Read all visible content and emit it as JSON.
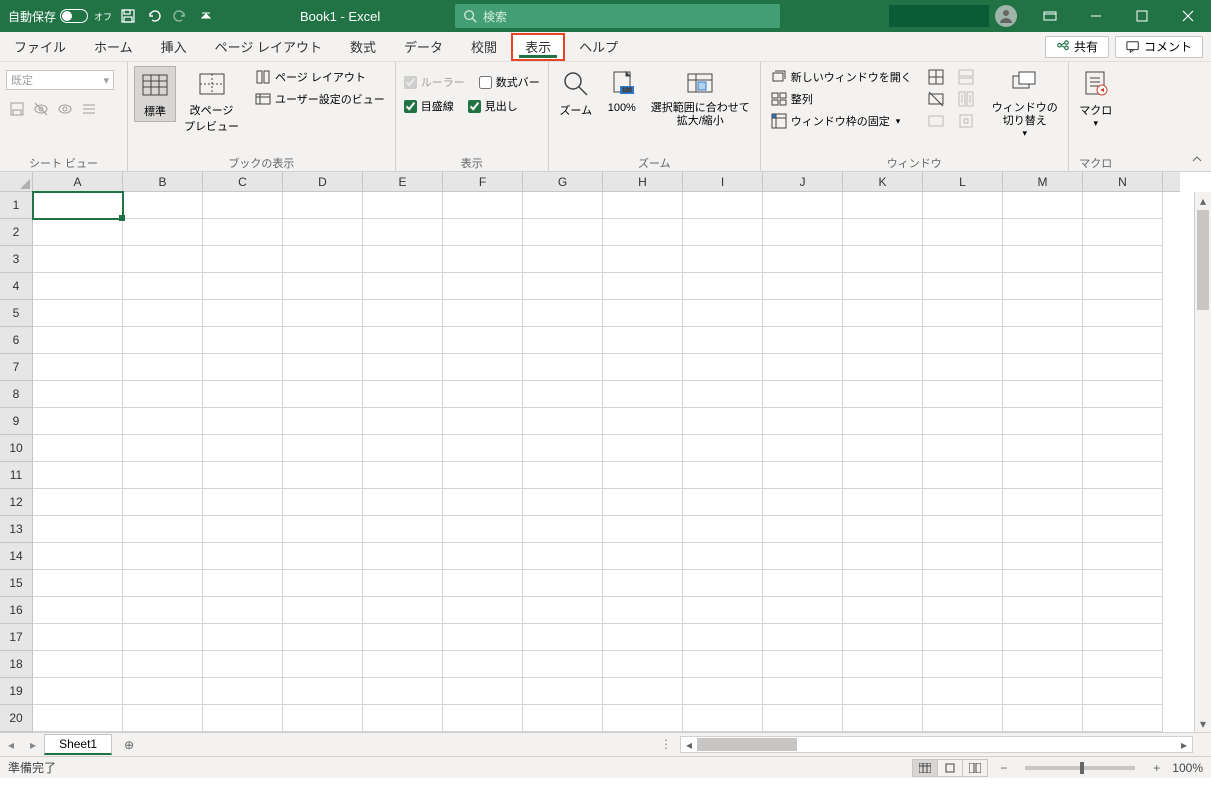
{
  "titlebar": {
    "autosave_label": "自動保存",
    "autosave_state": "オフ",
    "title": "Book1  -  Excel",
    "search_placeholder": "検索"
  },
  "tabs": {
    "file": "ファイル",
    "home": "ホーム",
    "insert": "挿入",
    "pagelayout": "ページ レイアウト",
    "formulas": "数式",
    "data": "データ",
    "review": "校閲",
    "view": "表示",
    "help": "ヘルプ",
    "share": "共有",
    "comment": "コメント"
  },
  "ribbon": {
    "sheetview": {
      "dropdown": "既定",
      "group_label": "シート ビュー"
    },
    "workbookviews": {
      "normal": "標準",
      "pagebreak": "改ページ\nプレビュー",
      "pagelayout": "ページ レイアウト",
      "customviews": "ユーザー設定のビュー",
      "group_label": "ブックの表示"
    },
    "show": {
      "ruler": "ルーラー",
      "formulabar": "数式バー",
      "gridlines": "目盛線",
      "headings": "見出し",
      "group_label": "表示"
    },
    "zoom": {
      "zoom": "ズーム",
      "hundred": "100%",
      "selection": "選択範囲に合わせて\n拡大/縮小",
      "group_label": "ズーム"
    },
    "window": {
      "newwin": "新しいウィンドウを開く",
      "arrange": "整列",
      "freeze": "ウィンドウ枠の固定",
      "switch": "ウィンドウの\n切り替え",
      "group_label": "ウィンドウ"
    },
    "macros": {
      "macros": "マクロ",
      "group_label": "マクロ"
    }
  },
  "sheet": {
    "columns": [
      "A",
      "B",
      "C",
      "D",
      "E",
      "F",
      "G",
      "H",
      "I",
      "J",
      "K",
      "L",
      "M",
      "N"
    ],
    "rows": [
      "1",
      "2",
      "3",
      "4",
      "5",
      "6",
      "7",
      "8",
      "9",
      "10",
      "11",
      "12",
      "13",
      "14",
      "15",
      "16",
      "17",
      "18",
      "19",
      "20"
    ],
    "active_tab": "Sheet1"
  },
  "statusbar": {
    "ready": "準備完了",
    "zoom": "100%"
  }
}
